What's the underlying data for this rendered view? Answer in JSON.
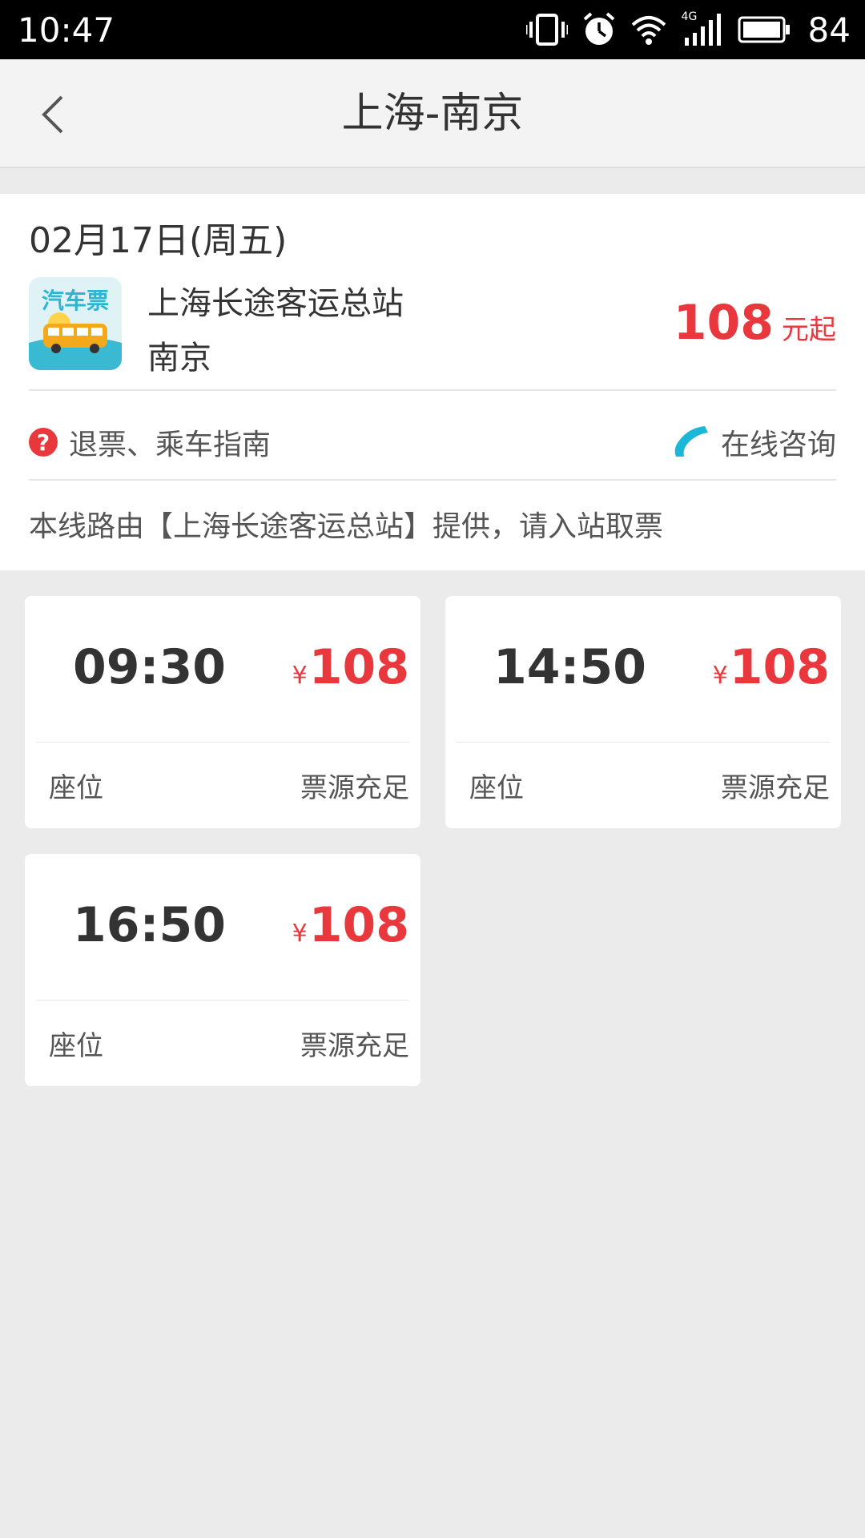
{
  "status_bar": {
    "time": "10:47",
    "battery": "84",
    "network": "4G"
  },
  "header": {
    "title": "上海-南京"
  },
  "trip": {
    "date": "02月17日(周五)",
    "logo_text": "汽车票",
    "depart_station": "上海长途客运总站",
    "arrive_city": "南京",
    "min_price": "108",
    "min_price_unit": "元起",
    "help_link": "退票、乘车指南",
    "help_icon": "?",
    "consult_link": "在线咨询",
    "provider_note": "本线路由【上海长途客运总站】提供，请入站取票"
  },
  "schedules": [
    {
      "time": "09:30",
      "currency": "¥",
      "price": "108",
      "seat_label": "座位",
      "availability": "票源充足"
    },
    {
      "time": "14:50",
      "currency": "¥",
      "price": "108",
      "seat_label": "座位",
      "availability": "票源充足"
    },
    {
      "time": "16:50",
      "currency": "¥",
      "price": "108",
      "seat_label": "座位",
      "availability": "票源充足"
    }
  ],
  "colors": {
    "accent_red": "#e8383d",
    "phone_blue": "#1ab8d6",
    "background": "#ebebeb"
  }
}
